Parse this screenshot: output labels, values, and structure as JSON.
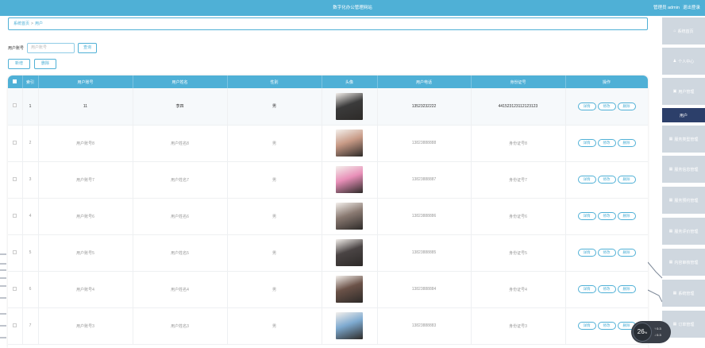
{
  "header": {
    "title": "数字化办公管理网站",
    "links": [
      "管理员 admin",
      "退出登录"
    ]
  },
  "breadcrumb": {
    "home": "系统首页",
    "separator": ">",
    "current": "用户"
  },
  "search": {
    "label": "用户账号",
    "placeholder": "用户账号",
    "button": "查询"
  },
  "actions": {
    "add": "新增",
    "delete": "删除"
  },
  "sidebar": {
    "items": [
      {
        "label": "系统首页",
        "icon": "home-icon"
      },
      {
        "label": "个人中心",
        "icon": "user-icon"
      },
      {
        "label": "用户管理",
        "icon": "users-icon"
      },
      {
        "label": "用户",
        "icon": "",
        "active": true
      },
      {
        "label": "服务类型管理",
        "icon": "grid-icon"
      },
      {
        "label": "服务信息管理",
        "icon": "grid-icon"
      },
      {
        "label": "服务预约管理",
        "icon": "grid-icon"
      },
      {
        "label": "服务评价管理",
        "icon": "grid-icon"
      },
      {
        "label": "内容审核管理",
        "icon": "grid-icon"
      },
      {
        "label": "系统管理",
        "icon": "grid-icon"
      },
      {
        "label": "订单管理",
        "icon": "grid-icon"
      }
    ]
  },
  "table": {
    "headers": [
      "",
      "索引",
      "用户账号",
      "用户姓名",
      "性别",
      "头像",
      "用户电话",
      "身份证号",
      "操作"
    ],
    "ops": [
      "详情",
      "修改",
      "删除"
    ],
    "rows": [
      {
        "index": "1",
        "account": "11",
        "name": "李四",
        "gender": "男",
        "phone": "13523232222",
        "idcard": "441523123112123123",
        "photo_color": "#3b3b3b"
      },
      {
        "index": "2",
        "account": "用户账号8",
        "name": "用户姓名8",
        "gender": "男",
        "phone": "13823888888",
        "idcard": "身份证号8",
        "photo_color": "#c89a86"
      },
      {
        "index": "3",
        "account": "用户账号7",
        "name": "用户姓名7",
        "gender": "男",
        "phone": "13823888887",
        "idcard": "身份证号7",
        "photo_color": "#e88fb8"
      },
      {
        "index": "4",
        "account": "用户账号6",
        "name": "用户姓名6",
        "gender": "男",
        "phone": "13823888886",
        "idcard": "身份证号6",
        "photo_color": "#8a7a72"
      },
      {
        "index": "5",
        "account": "用户账号5",
        "name": "用户姓名5",
        "gender": "男",
        "phone": "13823888885",
        "idcard": "身份证号5",
        "photo_color": "#4a4444"
      },
      {
        "index": "6",
        "account": "用户账号4",
        "name": "用户姓名4",
        "gender": "男",
        "phone": "13823888884",
        "idcard": "身份证号4",
        "photo_color": "#6b5248"
      },
      {
        "index": "7",
        "account": "用户账号3",
        "name": "用户姓名3",
        "gender": "男",
        "phone": "13823888883",
        "idcard": "身份证号3",
        "photo_color": "#7eaad0"
      }
    ]
  },
  "widget": {
    "percent": "26",
    "unit": "%",
    "up": "0.3",
    "down": "0.3"
  },
  "colors": {
    "accent": "#4fb0d6",
    "sidebar_active": "#2c3f6a",
    "sidebar": "#cfd7df"
  }
}
